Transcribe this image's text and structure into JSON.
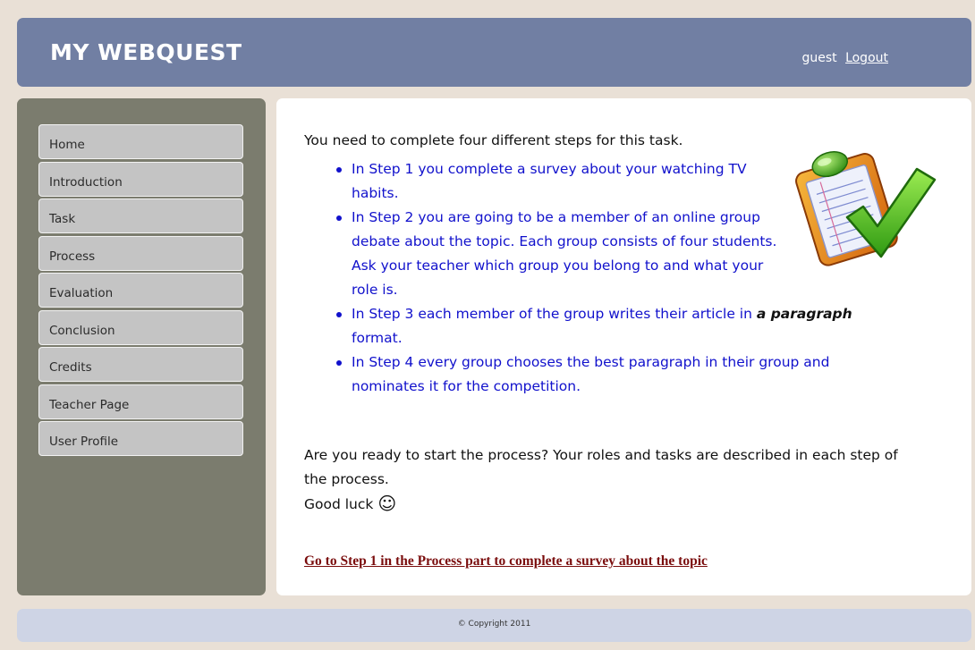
{
  "header": {
    "site_title": "MY WEBQUEST",
    "username": "guest",
    "logout_label": "Logout"
  },
  "sidebar": {
    "items": [
      {
        "label": "Home"
      },
      {
        "label": "Introduction"
      },
      {
        "label": "Task"
      },
      {
        "label": "Process"
      },
      {
        "label": "Evaluation"
      },
      {
        "label": "Conclusion"
      },
      {
        "label": "Credits"
      },
      {
        "label": "Teacher Page"
      },
      {
        "label": "User Profile"
      }
    ]
  },
  "content": {
    "intro": "You need to complete four different steps for this task.",
    "steps": [
      {
        "before": "In Step 1 you complete a survey about your watching TV habits.",
        "emphasis": "",
        "after": ""
      },
      {
        "before": "In Step 2 you are going to be a member of an online group debate about the topic. Each group consists of four students. Ask your teacher which group you belong to and what your role is.",
        "emphasis": "",
        "after": ""
      },
      {
        "before": "In Step 3 each member of the group writes their article in ",
        "emphasis": "a paragraph",
        "after": " format."
      },
      {
        "before": "In Step 4 every group chooses the best paragraph in their group and nominates it for the competition.",
        "emphasis": "",
        "after": ""
      }
    ],
    "ready_text": "Are you ready to start the process? Your roles and tasks are described in each step of the process.",
    "good_luck": "Good luck",
    "smiley": "☺",
    "cta_link": "Go to Step 1 in the Process part to complete a survey about the topic",
    "image_icon": "clipboard-checkmark-icon"
  },
  "footer": {
    "copyright": "© Copyright 2011"
  },
  "colors": {
    "header_bg": "#717fa3",
    "sidebar_bg": "#7b7c6e",
    "page_bg": "#e9e0d6",
    "step_text": "#1111cc",
    "cta_link": "#7a0d0d",
    "footer_bg": "#ced4e5"
  }
}
